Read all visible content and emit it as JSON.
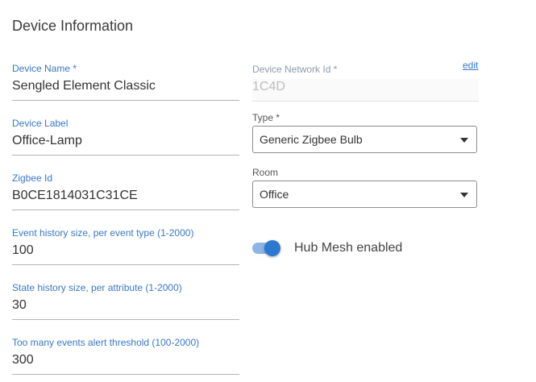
{
  "section_title": "Device Information",
  "device_name": {
    "label": "Device Name *",
    "value": "Sengled Element Classic"
  },
  "device_label": {
    "label": "Device Label",
    "value": "Office-Lamp"
  },
  "zigbee_id": {
    "label": "Zigbee Id",
    "value": "B0CE1814031C31CE"
  },
  "event_history": {
    "label": "Event history size, per event type (1-2000)",
    "value": "100"
  },
  "state_history": {
    "label": "State history size, per attribute (1-2000)",
    "value": "30"
  },
  "alert_threshold": {
    "label": "Too many events alert threshold (100-2000)",
    "value": "300"
  },
  "network_id": {
    "label": "Device Network Id *",
    "value": "1C4D",
    "edit_label": "edit"
  },
  "type": {
    "label": "Type *",
    "value": "Generic Zigbee Bulb"
  },
  "room": {
    "label": "Room",
    "value": "Office"
  },
  "hub_mesh": {
    "label": "Hub Mesh enabled",
    "enabled": true
  },
  "colors": {
    "accent": "#2f78d1",
    "label_blue": "#3a78c2"
  }
}
